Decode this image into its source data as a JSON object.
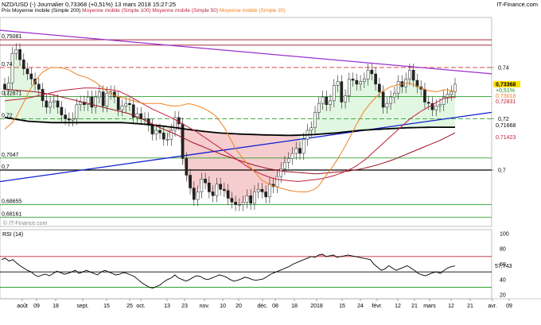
{
  "header": {
    "title": "NZD/USD (-)   Journalier   0,73368 (+0,51%)   13 mars 2018 15:27:25",
    "brand": "IT-Finance.com"
  },
  "legend": {
    "items": [
      {
        "label": "Prix Moyenne mobile (Simple 200)",
        "color": "#000000"
      },
      {
        "label": "Moyenne mobile (Simple 100)",
        "color": "#c0203a"
      },
      {
        "label": "Moyenne mobile (Simple 50)",
        "color": "#c0203a"
      },
      {
        "label": "Moyenne mobile (Simple 20)",
        "color": "#f08020"
      }
    ]
  },
  "watermark": "© IT-Finance.com",
  "chart_data": [
    {
      "type": "line",
      "title": "NZD/USD (-) Journalier",
      "ylim": [
        0.678,
        0.7595
      ],
      "y_ticks_right": [
        "0,74",
        "0,72",
        "0,7"
      ],
      "y_ticks_left": [
        "0,75081",
        "0,74",
        "0,72871",
        "0,72",
        "0,7047",
        "0,7",
        "0,68655",
        "0,68161"
      ],
      "x_ticks": [
        "août",
        "09",
        "18",
        "sept.",
        "15",
        "25",
        "oct.",
        "13",
        "23",
        "nov.",
        "10",
        "20",
        "déc.",
        "08",
        "18",
        "2018",
        "15",
        "24",
        "févr.",
        "12",
        "21",
        "mars",
        "12",
        "21",
        "avr.",
        "09"
      ],
      "last_price_label": "0,73368",
      "change_label": "+0,51%",
      "ma_labels": [
        {
          "text": "0,73018",
          "color": "#f08020"
        },
        {
          "text": "0,72831",
          "color": "#c0203a"
        },
        {
          "text": "0,71668",
          "color": "#000000"
        },
        {
          "text": "0,71423",
          "color": "#c0203a"
        }
      ],
      "horizontal_levels": [
        {
          "value": 0.7508,
          "color": "#9a1020",
          "style": "solid"
        },
        {
          "value": 0.7487,
          "color": "#9a1020",
          "style": "solid"
        },
        {
          "value": 0.74,
          "color": "#d03030",
          "style": "dashed"
        },
        {
          "value": 0.7287,
          "color": "#30a030",
          "style": "solid"
        },
        {
          "value": 0.72,
          "color": "#30a030",
          "style": "dashed"
        },
        {
          "value": 0.7047,
          "color": "#30a030",
          "style": "solid"
        },
        {
          "value": 0.7,
          "color": "#000000",
          "style": "solid"
        },
        {
          "value": 0.68655,
          "color": "#30a030",
          "style": "solid"
        },
        {
          "value": 0.68161,
          "color": "#30a030",
          "style": "solid"
        }
      ],
      "close_series": [
        0.7315,
        0.734,
        0.7455,
        0.747,
        0.743,
        0.7395,
        0.7375,
        0.7355,
        0.7335,
        0.7315,
        0.727,
        0.7245,
        0.7265,
        0.727,
        0.7245,
        0.7215,
        0.72,
        0.7195,
        0.72,
        0.7255,
        0.7265,
        0.7255,
        0.7285,
        0.7245,
        0.7285,
        0.7305,
        0.725,
        0.73,
        0.7305,
        0.7285,
        0.7235,
        0.725,
        0.726,
        0.7255,
        0.7205,
        0.722,
        0.72,
        0.72,
        0.7175,
        0.714,
        0.7155,
        0.7145,
        0.712,
        0.712,
        0.7155,
        0.7205,
        0.718,
        0.7045,
        0.698,
        0.693,
        0.6885,
        0.6915,
        0.6965,
        0.695,
        0.6915,
        0.69,
        0.6945,
        0.6925,
        0.692,
        0.689,
        0.6875,
        0.6865,
        0.6865,
        0.6875,
        0.69,
        0.687,
        0.6915,
        0.6925,
        0.6915,
        0.6895,
        0.6945,
        0.6935,
        0.6975,
        0.7005,
        0.703,
        0.7045,
        0.7065,
        0.7085,
        0.7065,
        0.712,
        0.7155,
        0.7165,
        0.7225,
        0.726,
        0.7285,
        0.7255,
        0.727,
        0.733,
        0.7345,
        0.7265,
        0.729,
        0.7355,
        0.735,
        0.7335,
        0.7345,
        0.7355,
        0.739,
        0.7375,
        0.7335,
        0.7305,
        0.7245,
        0.726,
        0.7285,
        0.73,
        0.7345,
        0.7325,
        0.7355,
        0.739,
        0.735,
        0.7325,
        0.7315,
        0.7265,
        0.726,
        0.7235,
        0.725,
        0.7255,
        0.7285,
        0.7295,
        0.7305,
        0.7335
      ],
      "sma20": [
        0.716,
        0.719,
        0.726,
        0.733,
        0.738,
        0.74,
        0.74,
        0.739,
        0.737,
        0.736,
        0.734,
        0.731,
        0.729,
        0.728,
        0.727,
        0.726,
        0.726,
        0.726,
        0.725,
        0.725,
        0.726,
        0.725,
        0.7235,
        0.721,
        0.716,
        0.709,
        0.704,
        0.7,
        0.696,
        0.694,
        0.693,
        0.692,
        0.6915,
        0.6915,
        0.693,
        0.698,
        0.703,
        0.709,
        0.716,
        0.7225,
        0.727,
        0.7305,
        0.7325,
        0.7335,
        0.734,
        0.7325,
        0.731,
        0.7305,
        0.7315,
        0.7305
      ],
      "sma50": [
        0.727,
        0.7275,
        0.728,
        0.729,
        0.73,
        0.731,
        0.7315,
        0.732,
        0.732,
        0.7315,
        0.731,
        0.729,
        0.7265,
        0.724,
        0.722,
        0.72,
        0.7175,
        0.715,
        0.712,
        0.709,
        0.706,
        0.703,
        0.7,
        0.698,
        0.6965,
        0.696,
        0.6955,
        0.696,
        0.6965,
        0.6975,
        0.699,
        0.701,
        0.704,
        0.708,
        0.712,
        0.716,
        0.72,
        0.723,
        0.7255,
        0.728,
        0.7285
      ],
      "sma100": [
        0.7315,
        0.731,
        0.7305,
        0.7295,
        0.728,
        0.7265,
        0.725,
        0.7235,
        0.722,
        0.7195,
        0.7165,
        0.714,
        0.711,
        0.7085,
        0.706,
        0.704,
        0.702,
        0.7005,
        0.6995,
        0.699,
        0.6985,
        0.699,
        0.6995,
        0.7005,
        0.702,
        0.704,
        0.7065,
        0.709,
        0.7115,
        0.7145
      ],
      "sma200": [
        0.7205,
        0.719,
        0.7185,
        0.7185,
        0.7185,
        0.7185,
        0.7178,
        0.7168,
        0.7155,
        0.7145,
        0.714,
        0.7137,
        0.7135,
        0.7138,
        0.7145,
        0.7155,
        0.716,
        0.7165,
        0.7167,
        0.7167
      ],
      "trendlines": [
        {
          "name": "resistance",
          "from": [
            0,
            0.7545
          ],
          "to": [
            1.0,
            0.7388
          ],
          "color": "#9b30d0"
        },
        {
          "name": "support",
          "from": [
            0,
            0.6955
          ],
          "to": [
            1.0,
            0.7205
          ],
          "color": "#1020d0"
        }
      ]
    },
    {
      "type": "line",
      "title": "RSI (14)",
      "ylim": [
        15,
        105
      ],
      "y_ticks_right": [
        "100",
        "80",
        "60",
        "40",
        "20"
      ],
      "last_value_label": "57,743",
      "levels": [
        {
          "value": 70,
          "color": "#c0203a"
        },
        {
          "value": 50,
          "color": "#000000"
        },
        {
          "value": 30,
          "color": "#30a030"
        }
      ],
      "values": [
        66,
        68,
        64,
        66,
        62,
        58,
        55,
        52,
        50,
        46,
        44,
        46,
        47,
        45,
        48,
        51,
        49,
        47,
        48,
        50,
        52,
        48,
        50,
        52,
        50,
        48,
        46,
        50,
        52,
        50,
        48,
        46,
        47,
        49,
        48,
        46,
        44,
        40,
        36,
        33,
        30,
        29,
        31,
        33,
        37,
        40,
        42,
        46,
        42,
        40,
        38,
        40,
        43,
        45,
        44,
        41,
        40,
        42,
        44,
        46,
        45,
        43,
        40,
        38,
        39,
        41,
        43,
        42,
        40,
        39,
        40,
        41,
        44,
        47,
        49,
        51,
        53,
        55,
        57,
        60,
        62,
        64,
        66,
        68,
        70,
        69,
        72,
        73,
        70,
        71,
        72,
        69,
        70,
        71,
        72,
        71,
        70,
        69,
        68,
        67,
        66,
        60,
        56,
        52,
        54,
        58,
        55,
        52,
        54,
        56,
        58,
        55,
        52,
        48,
        46,
        45,
        47,
        49,
        50,
        48,
        52,
        55,
        57,
        57.7
      ]
    }
  ]
}
